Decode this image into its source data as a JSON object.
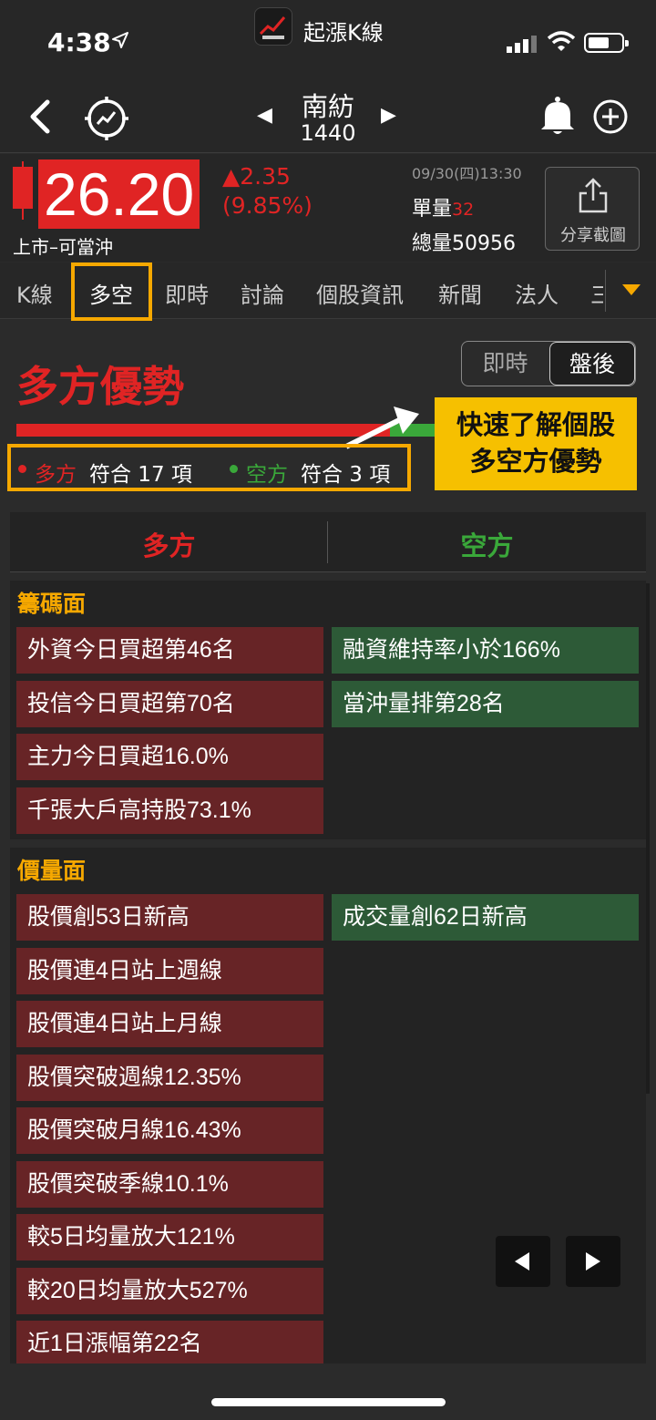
{
  "status_bar": {
    "time": "4:38",
    "app_name": "起漲K線"
  },
  "stock": {
    "name": "南紡",
    "code": "1440"
  },
  "quote": {
    "price": "26.20",
    "change": "▲2.35",
    "change_pct": "(9.85%)",
    "market_type": "上市–可當沖",
    "datetime": "09/30(四)13:30",
    "unit_vol_label": "單量",
    "unit_vol": "32",
    "total_vol_label": "總量",
    "total_vol": "50956",
    "share_label": "分享截圖"
  },
  "tabs": [
    "K線",
    "多空",
    "即時",
    "討論",
    "個股資訊",
    "新聞",
    "法人",
    "三"
  ],
  "active_tab": "多空",
  "summary": {
    "title": "多方優勢",
    "mode_options": [
      "即時",
      "盤後"
    ],
    "mode_selected": "盤後",
    "bull_ratio": 0.85,
    "bull_label": "多方",
    "bull_text": "符合 17 項",
    "bear_label": "空方",
    "bear_text": "符合 3 項",
    "callout_line1": "快速了解個股",
    "callout_line2": "多空方優勢"
  },
  "columns": {
    "bull": "多方",
    "bear": "空方"
  },
  "sections": [
    {
      "title": "籌碼面",
      "bull": [
        "外資今日買超第46名",
        "投信今日買超第70名",
        "主力今日買超16.0%",
        "千張大戶高持股73.1%"
      ],
      "bear": [
        "融資維持率小於166%",
        "當沖量排第28名"
      ]
    },
    {
      "title": "價量面",
      "bull": [
        "股價創53日新高",
        "股價連4日站上週線",
        "股價連4日站上月線",
        "股價突破週線12.35%",
        "股價突破月線16.43%",
        "股價突破季線10.1%",
        "較5日均量放大121%",
        "較20日均量放大527%",
        "近1日漲幅第22名"
      ],
      "bear": [
        "成交量創62日新高"
      ]
    }
  ],
  "colors": {
    "bull": "#e02424",
    "bear": "#3aa83a",
    "accent": "#f6a800"
  }
}
